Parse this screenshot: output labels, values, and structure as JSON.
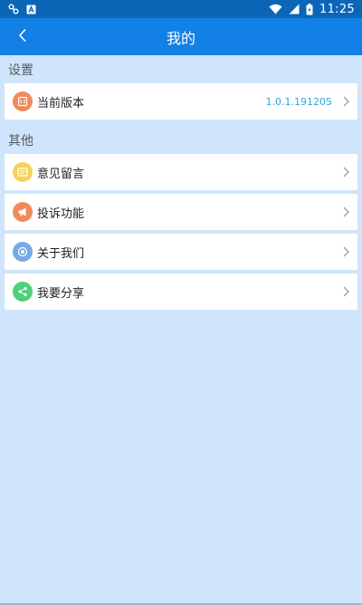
{
  "status_bar": {
    "time": "11:25",
    "left_icons": [
      "link-icon",
      "app-a-icon"
    ],
    "right_icons": [
      "wifi-icon",
      "signal-icon",
      "battery-icon"
    ]
  },
  "app_bar": {
    "title": "我的",
    "back_icon": "chevron-left-icon"
  },
  "sections": {
    "settings_title": "设置",
    "others_title": "其他"
  },
  "rows": {
    "version": {
      "label": "当前版本",
      "value": "1.0.1.191205",
      "icon": "version-icon",
      "color": "#f08a5c"
    },
    "feedback": {
      "label": "意见留言",
      "icon": "message-icon",
      "color": "#f5d35b"
    },
    "complaint": {
      "label": "投诉功能",
      "icon": "megaphone-icon",
      "color": "#f08a5c"
    },
    "about": {
      "label": "关于我们",
      "icon": "about-icon",
      "color": "#78a9e6"
    },
    "share": {
      "label": "我要分享",
      "icon": "share-icon",
      "color": "#4fd07c"
    }
  },
  "colors": {
    "status_bar": "#0b66b8",
    "app_bar": "#1380e6",
    "background": "#cfe5fb",
    "version_value": "#36a3e0"
  }
}
